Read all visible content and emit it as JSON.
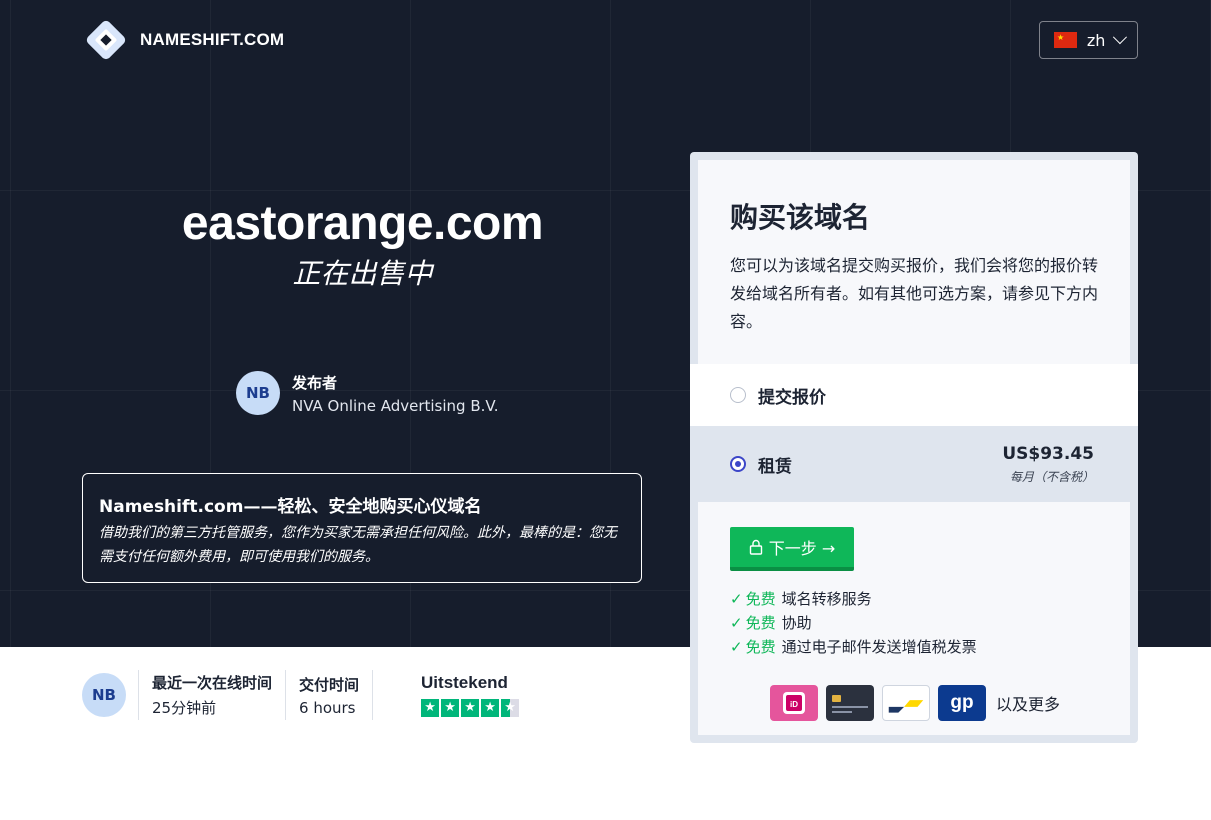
{
  "header": {
    "logo_text": "NAMESHIFT.COM",
    "language": {
      "code": "zh",
      "flag": "china-flag-icon"
    }
  },
  "hero": {
    "domain": "eastorange.com",
    "subtitle": "正在出售中",
    "publisher": {
      "initials": "NB",
      "label": "发布者",
      "name": "NVA Online Advertising B.V."
    },
    "promo": {
      "title": "Nameshift.com——轻松、安全地购买心仪域名",
      "text": "借助我们的第三方托管服务，您作为买家无需承担任何风险。此外，最棒的是：您无需支付任何额外费用，即可使用我们的服务。"
    }
  },
  "stats": {
    "initials": "NB",
    "last_online_label": "最近一次在线时间",
    "last_online_value": "25分钟前",
    "delivery_label": "交付时间",
    "delivery_value": "6 hours",
    "trustpilot_label": "Uitstekend",
    "trustpilot_rating": 4.5
  },
  "card": {
    "title": "购买该域名",
    "description": "您可以为该域名提交购买报价，我们会将您的报价转发给域名所有者。如有其他可选方案，请参见下方内容。",
    "options": {
      "offer_label": "提交报价",
      "rent_label": "租赁",
      "rent_price": "US$93.45",
      "rent_note": "每月（不含税）",
      "selected": "rent"
    },
    "next_button": "下一步 →",
    "perks": [
      {
        "free": "免费",
        "text": "域名转移服务"
      },
      {
        "free": "免费",
        "text": "协助"
      },
      {
        "free": "免费",
        "text": "通过电子邮件发送增值税发票"
      }
    ],
    "payments": {
      "methods": [
        "ideal-icon",
        "credit-card-icon",
        "bancontact-icon",
        "gp-icon"
      ],
      "gp_label": "gp",
      "more": "以及更多"
    }
  },
  "colors": {
    "hero_bg": "#161d2c",
    "accent_green": "#0fb759",
    "radio_blue": "#3c46c8",
    "trustpilot_green": "#00b67a"
  }
}
